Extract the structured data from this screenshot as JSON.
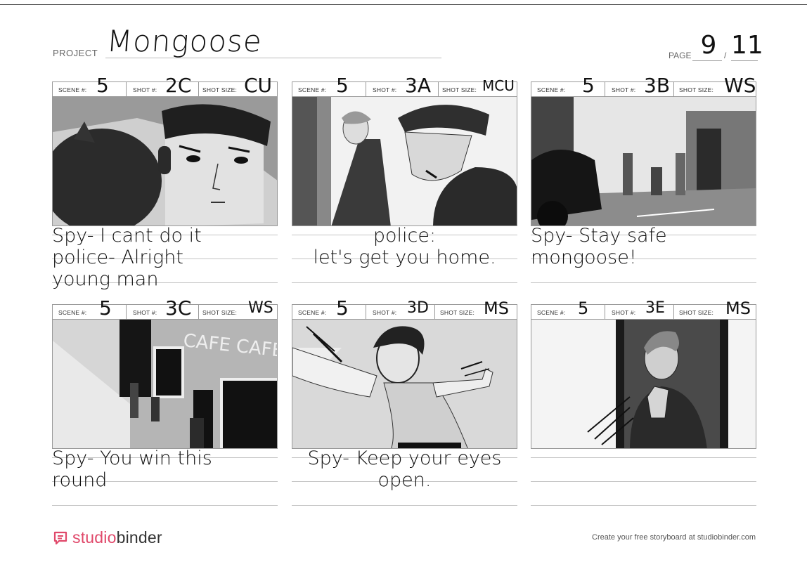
{
  "header": {
    "project_label": "PROJECT",
    "project_name": "Mongoose",
    "page_label": "PAGE",
    "page_current": "9",
    "page_separator": "/",
    "page_total": "11"
  },
  "labels": {
    "scene": "SCENE #:",
    "shot": "SHOT #:",
    "shot_size": "SHOT SIZE:"
  },
  "panels": [
    {
      "scene": "5",
      "shot": "2C",
      "size": "CU",
      "caption": "Spy- I cant do it\n       police- Alright\n                 young man"
    },
    {
      "scene": "5",
      "shot": "3A",
      "size": "MCU",
      "caption": "police:\nlet's get you home."
    },
    {
      "scene": "5",
      "shot": "3B",
      "size": "WS",
      "caption": "Spy- Stay safe\n   mongoose!"
    },
    {
      "scene": "5",
      "shot": "3C",
      "size": "WS",
      "caption": "Spy- You win this\n  round"
    },
    {
      "scene": "5",
      "shot": "3D",
      "size": "MS",
      "caption": "Spy- Keep your eyes\nopen."
    },
    {
      "scene": "5",
      "shot": "3E",
      "size": "MS",
      "caption": ""
    }
  ],
  "artwork_text": {
    "cafe_sign": "CAFE CAFE"
  },
  "footer": {
    "brand_prefix": "studio",
    "brand_suffix": "binder",
    "note": "Create your free storyboard at studiobinder.com"
  },
  "colors": {
    "brand_accent": "#e0486a",
    "rule_gray": "#c4c4c4"
  }
}
